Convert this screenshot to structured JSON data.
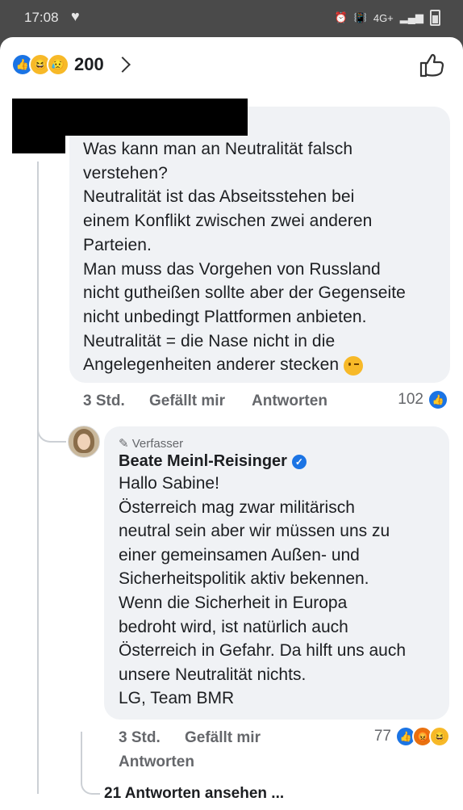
{
  "status_bar": {
    "time": "17:08",
    "network": "4G+"
  },
  "header": {
    "reaction_count": "200"
  },
  "comment1": {
    "text": "Was kann man an Neutralität falsch\nverstehen?\nNeutralität ist das Abseitsstehen bei\neinem Konflikt zwischen zwei anderen\nParteien.\nMan muss das Vorgehen von Russland\nnicht gutheißen sollte aber der Gegenseite\nnicht unbedingt Plattformen anbieten.\nNeutralität = die Nase nicht in die\nAngelegenheiten anderer stecken",
    "time": "3 Std.",
    "like_label": "Gefällt mir",
    "reply_label": "Antworten",
    "likes": "102"
  },
  "reply": {
    "badge": "Verfasser",
    "author": "Beate Meinl-Reisinger",
    "text": "Hallo Sabine!\nÖsterreich mag zwar militärisch\nneutral sein aber wir müssen uns zu\neiner gemeinsamen Außen- und\nSicherheitspolitik aktiv bekennen.\nWenn die Sicherheit in Europa\nbedroht wird, ist natürlich auch\nÖsterreich in Gefahr. Da hilft uns auch\nunsere Neutralität nichts.\nLG, Team BMR",
    "time": "3 Std.",
    "like_label": "Gefällt mir",
    "reply_label": "Antworten",
    "likes": "77"
  },
  "view_more": "21 Antworten ansehen ...",
  "colors": {
    "accent": "#1b74e4",
    "bubble": "#f0f2f5",
    "muted": "#65676b"
  }
}
